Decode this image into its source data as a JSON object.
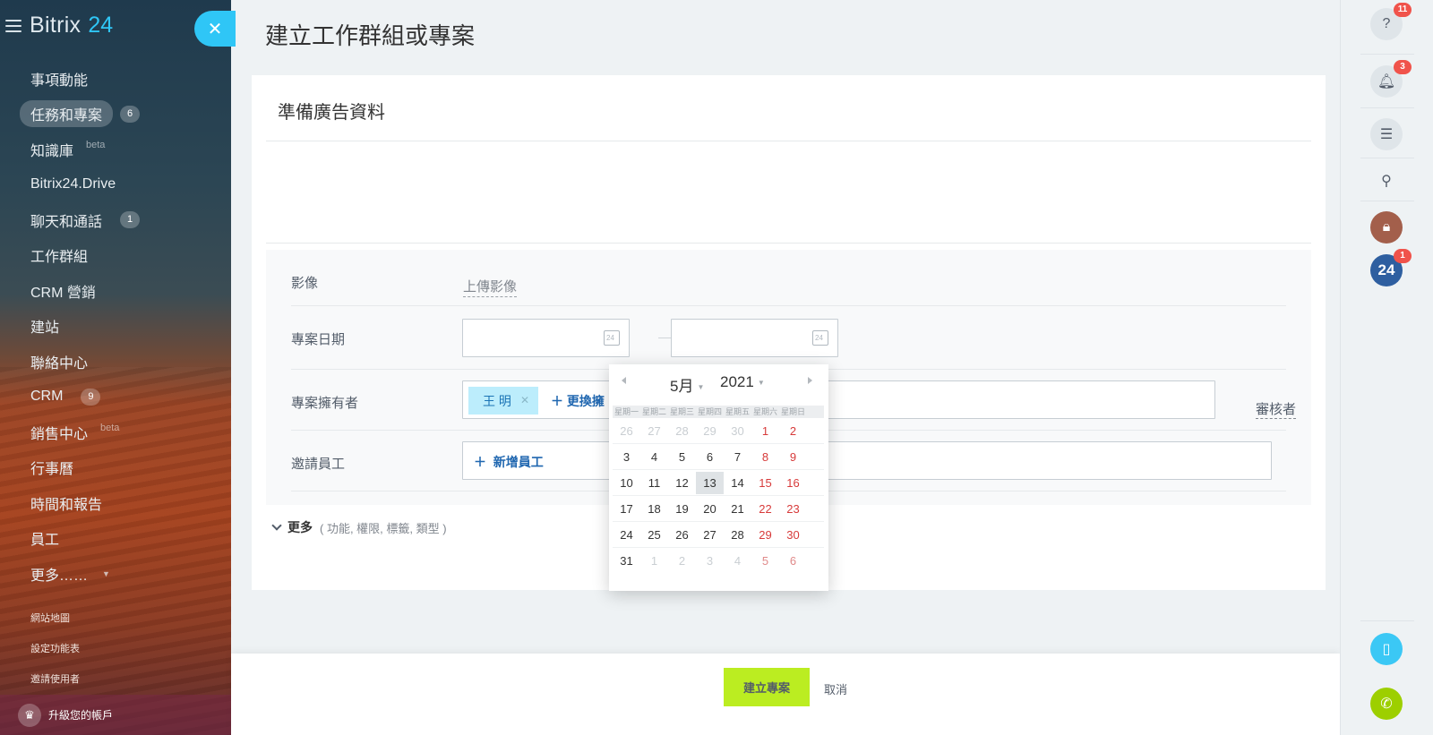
{
  "brand": {
    "name": "Bitrix",
    "num": "24"
  },
  "sidebar": {
    "items": [
      {
        "label": "事項動能",
        "counter": "",
        "sup": ""
      },
      {
        "label": "任務和專案",
        "counter": "6",
        "sup": ""
      },
      {
        "label": "知識庫",
        "counter": "",
        "sup": "beta"
      },
      {
        "label": "Bitrix24.Drive",
        "counter": "",
        "sup": ""
      },
      {
        "label": "聊天和通話",
        "counter": "1",
        "sup": ""
      },
      {
        "label": "工作群組",
        "counter": "",
        "sup": ""
      },
      {
        "label": "CRM 營銷",
        "counter": "",
        "sup": ""
      },
      {
        "label": "建站",
        "counter": "",
        "sup": ""
      },
      {
        "label": "聯絡中心",
        "counter": "",
        "sup": ""
      },
      {
        "label": "CRM",
        "counter": "9",
        "sup": ""
      },
      {
        "label": "銷售中心",
        "counter": "",
        "sup": "beta"
      },
      {
        "label": "行事曆",
        "counter": "",
        "sup": ""
      },
      {
        "label": "時間和報告",
        "counter": "",
        "sup": ""
      },
      {
        "label": "員工",
        "counter": "",
        "sup": ""
      },
      {
        "label": "更多……",
        "counter": "",
        "sup": ""
      }
    ],
    "footer_links": [
      "網站地圖",
      "設定功能表",
      "邀請使用者"
    ],
    "upgrade_label": "升級您的帳戶"
  },
  "main": {
    "page_title": "建立工作群組或專案",
    "task_title": "準備廣告資料",
    "image_label": "影像",
    "upload_label": "上傳影像",
    "date_label": "專案日期",
    "owner_label": "專案擁有者",
    "owner_tag": "王 明",
    "change_label": "更換擁",
    "reviewer_label": "審核者",
    "invite_label": "邀請員工",
    "add_employee_label": "新增員工",
    "more_label": "更多",
    "more_sub": "(  功能,  權限,  標籤,  類型  )"
  },
  "calendar": {
    "month": "5月",
    "year": "2021",
    "weekdays": [
      "星期一",
      "星期二",
      "星期三",
      "星期四",
      "星期五",
      "星期六",
      "星期日"
    ],
    "weeks": [
      [
        "26",
        "27",
        "28",
        "29",
        "30",
        "1",
        "2"
      ],
      [
        "3",
        "4",
        "5",
        "6",
        "7",
        "8",
        "9"
      ],
      [
        "10",
        "11",
        "12",
        "13",
        "14",
        "15",
        "16"
      ],
      [
        "17",
        "18",
        "19",
        "20",
        "21",
        "22",
        "23"
      ],
      [
        "24",
        "25",
        "26",
        "27",
        "28",
        "29",
        "30"
      ],
      [
        "31",
        "1",
        "2",
        "3",
        "4",
        "5",
        "6"
      ]
    ],
    "selected": "13"
  },
  "footer": {
    "create_label": "建立專案",
    "cancel_label": "取消"
  },
  "right_bar": {
    "help_badge": "11",
    "notify_badge": "3",
    "b24_badge": "1",
    "b24_label": "24"
  },
  "colors": {
    "accent": "#2fc6f6",
    "create_button": "#bbed21",
    "badge": "#f0534b",
    "weekend": "#d73a3a"
  }
}
